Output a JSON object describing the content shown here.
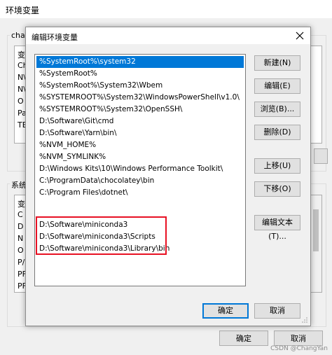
{
  "background_window": {
    "title": "环境变量",
    "user_group_label": "char",
    "system_group_label": "系统",
    "user_vars": [
      "变",
      "Ch",
      "N\\",
      "N\\",
      "O",
      "Pa",
      "TE"
    ],
    "system_vars": [
      "变",
      "C",
      "D",
      "N",
      "O",
      "P/",
      "PF",
      "PF"
    ],
    "ok_label": "确定",
    "cancel_label": "取消"
  },
  "dialog": {
    "title": "编辑环境变量",
    "paths": [
      "%SystemRoot%\\system32",
      "%SystemRoot%",
      "%SystemRoot%\\System32\\Wbem",
      "%SYSTEMROOT%\\System32\\WindowsPowerShell\\v1.0\\",
      "%SYSTEMROOT%\\System32\\OpenSSH\\",
      "D:\\Software\\Git\\cmd",
      "D:\\Software\\Yarn\\bin\\",
      "%NVM_HOME%",
      "%NVM_SYMLINK%",
      "D:\\Windows Kits\\10\\Windows Performance Toolkit\\",
      "C:\\ProgramData\\chocolatey\\bin",
      "C:\\Program Files\\dotnet\\",
      "D:\\Software\\miniconda3",
      "D:\\Software\\miniconda3\\Scripts",
      "D:\\Software\\miniconda3\\Library\\bin"
    ],
    "selected_index": 0,
    "buttons": {
      "new": "新建(N)",
      "edit": "编辑(E)",
      "browse": "浏览(B)...",
      "delete": "删除(D)",
      "move_up": "上移(U)",
      "move_down": "下移(O)",
      "edit_text": "编辑文本(T)..."
    },
    "ok_label": "确定",
    "cancel_label": "取消"
  },
  "colors": {
    "selection": "#0078d7",
    "highlight_box": "#e81123"
  },
  "watermark": "CSDN @ChangYan"
}
